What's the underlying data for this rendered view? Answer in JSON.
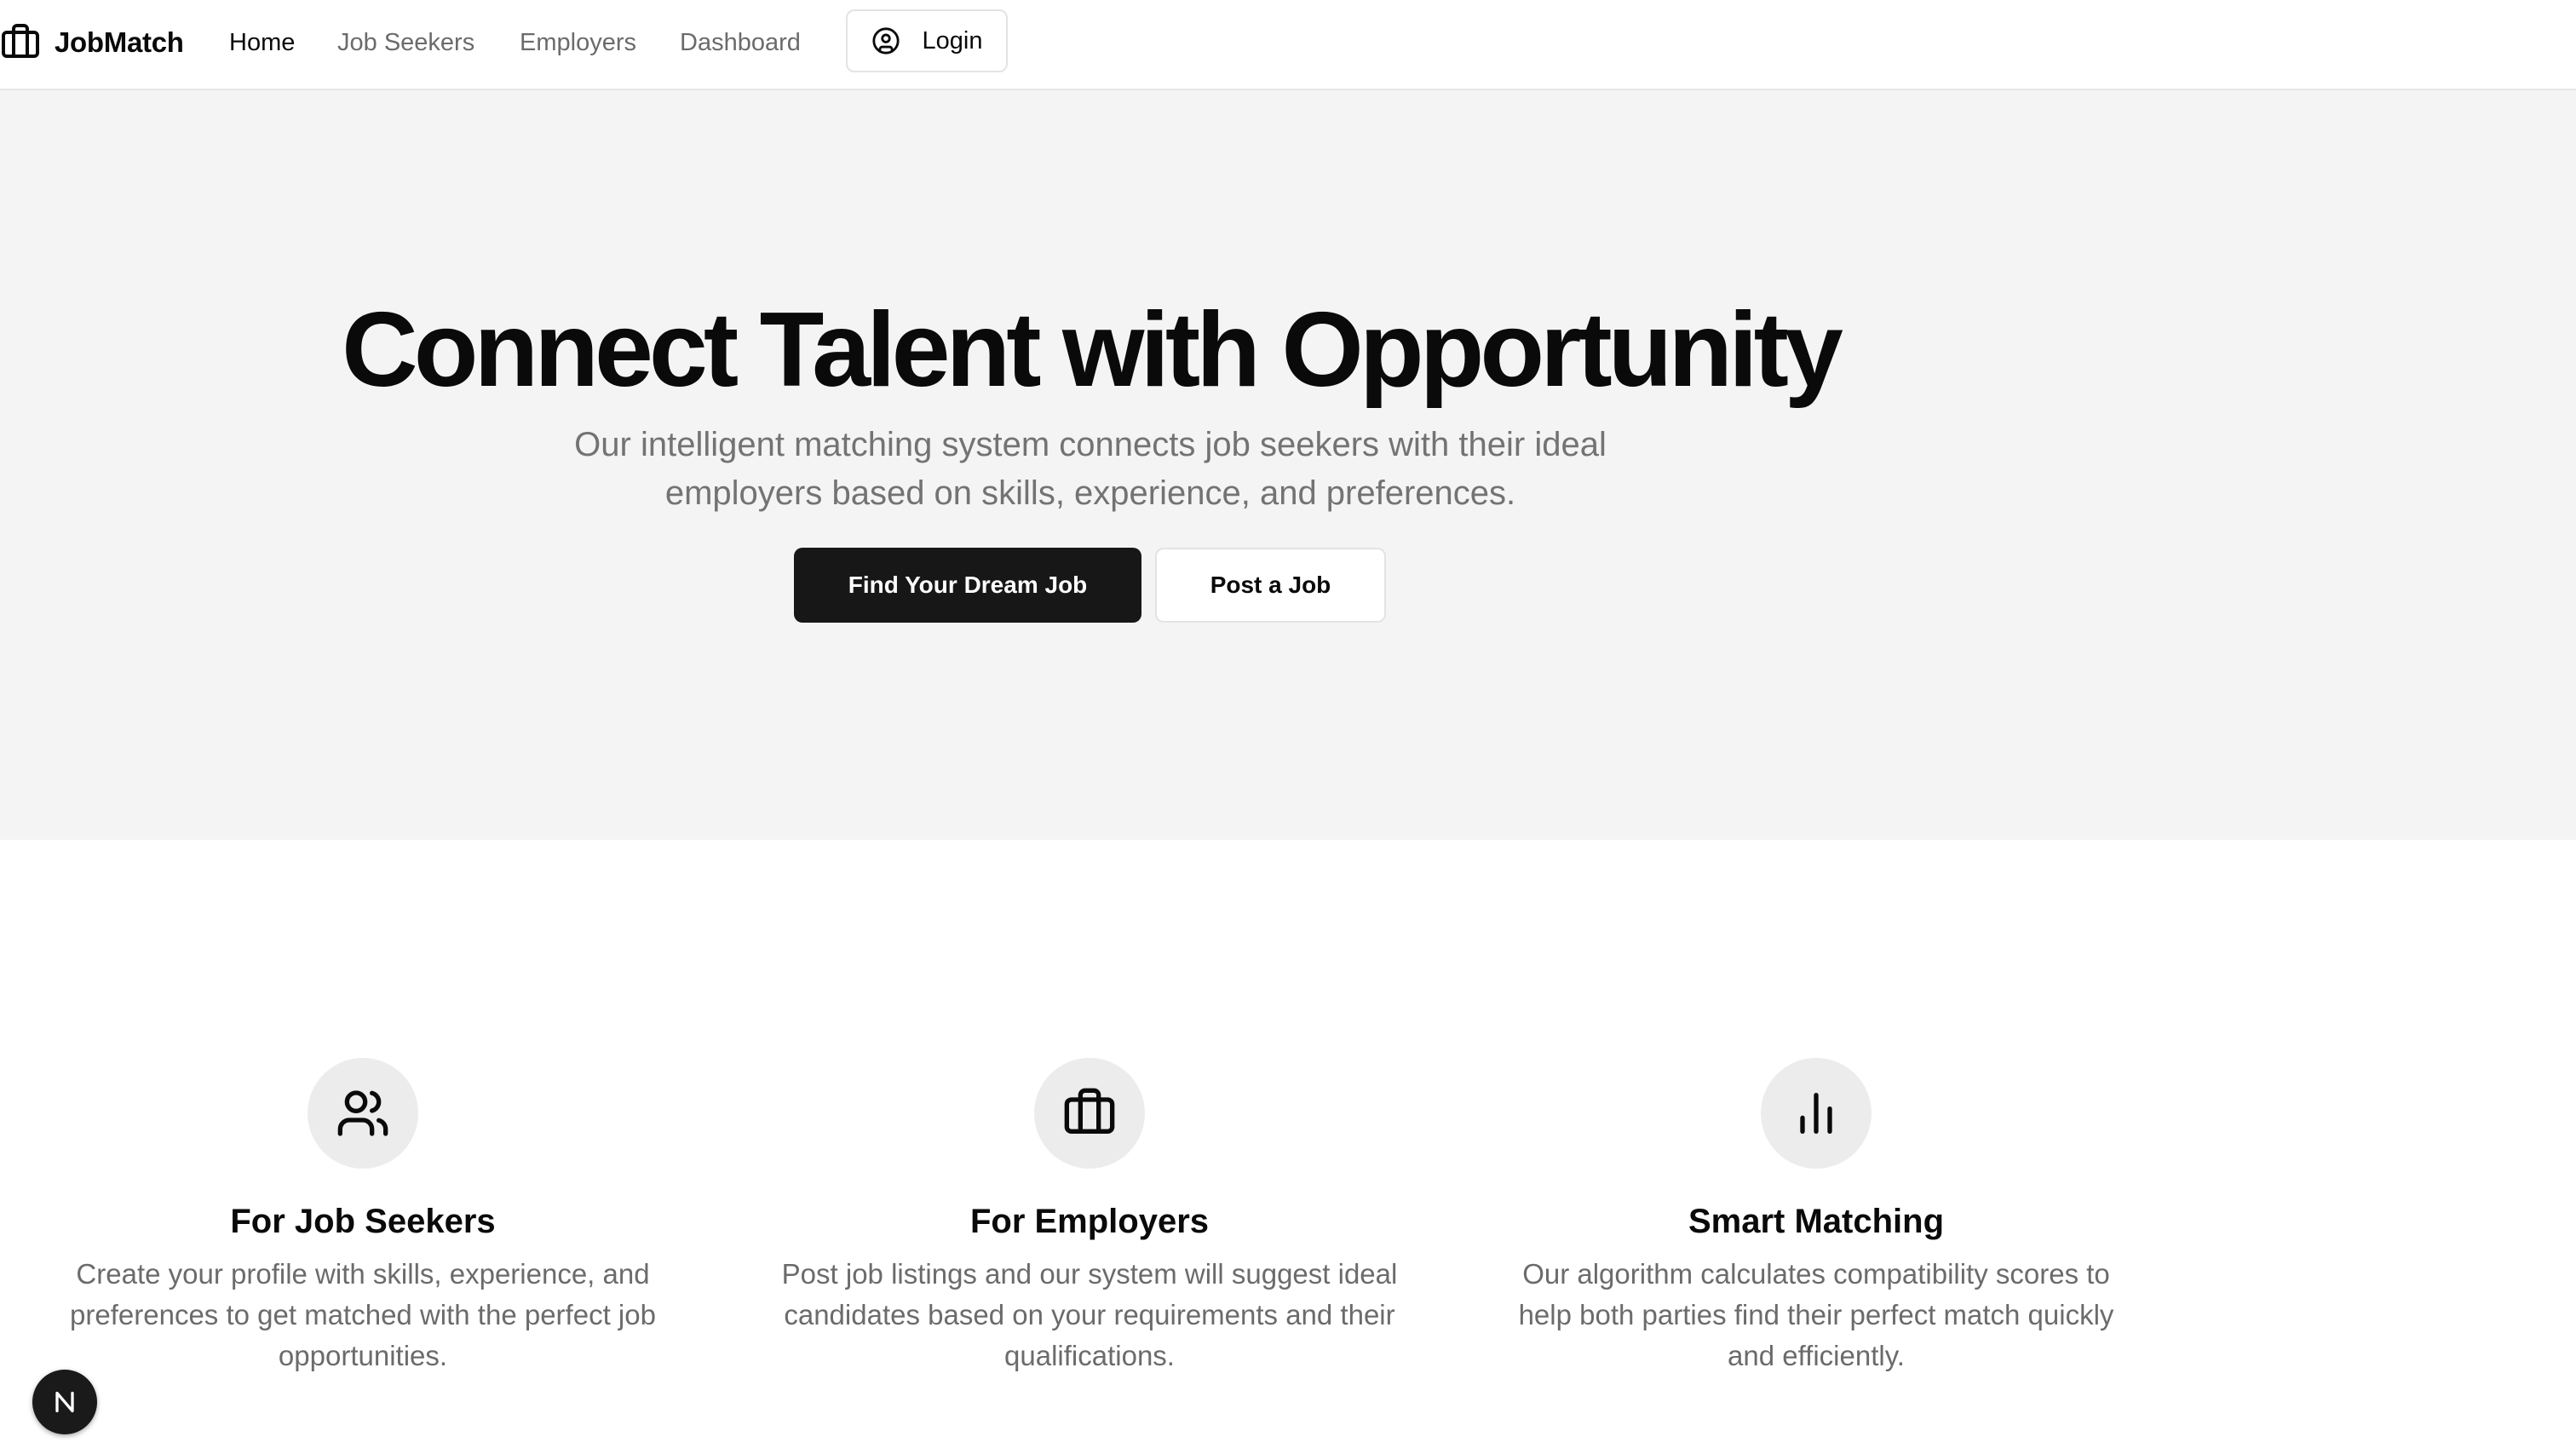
{
  "brand": {
    "name": "JobMatch",
    "icon": "briefcase-icon"
  },
  "nav": {
    "items": [
      {
        "label": "Home",
        "active": true
      },
      {
        "label": "Job Seekers",
        "active": false
      },
      {
        "label": "Employers",
        "active": false
      },
      {
        "label": "Dashboard",
        "active": false
      }
    ],
    "login": {
      "label": "Login",
      "icon": "user-circle-icon"
    }
  },
  "hero": {
    "title": "Connect Talent with Opportunity",
    "subtitle_line1": "Our intelligent matching system connects job seekers with their ideal",
    "subtitle_line2": "employers based on skills, experience, and preferences.",
    "primary_button": "Find Your Dream Job",
    "secondary_button": "Post a Job"
  },
  "features": [
    {
      "icon": "users-icon",
      "title": "For Job Seekers",
      "description": "Create your profile with skills, experience, and preferences to get matched with the perfect job opportunities."
    },
    {
      "icon": "briefcase-icon",
      "title": "For Employers",
      "description": "Post job listings and our system will suggest ideal candidates based on your requirements and their qualifications."
    },
    {
      "icon": "bar-chart-icon",
      "title": "Smart Matching",
      "description": "Our algorithm calculates compatibility scores to help both parties find their perfect match quickly and efficiently."
    }
  ],
  "badge": {
    "icon": "n-logo-icon"
  },
  "colors": {
    "hero_bg": "#f4f4f4",
    "primary": "#171717",
    "muted_text": "#737373",
    "icon_circle": "#ececec"
  }
}
